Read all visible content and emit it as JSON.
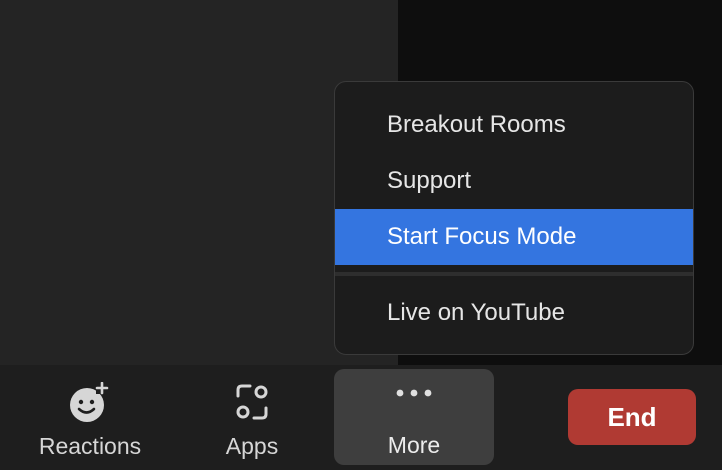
{
  "menu": {
    "items": [
      {
        "label": "Breakout Rooms"
      },
      {
        "label": "Support"
      },
      {
        "label": "Start Focus Mode"
      },
      {
        "label": "Live on YouTube"
      }
    ],
    "highlight_color": "#3475e0"
  },
  "toolbar": {
    "reactions_label": "Reactions",
    "apps_label": "Apps",
    "more_label": "More",
    "end_label": "End",
    "end_color": "#b03a33"
  },
  "icons": {
    "reactions": "emoji-add-icon",
    "apps": "apps-icon",
    "more": "ellipsis-icon"
  }
}
